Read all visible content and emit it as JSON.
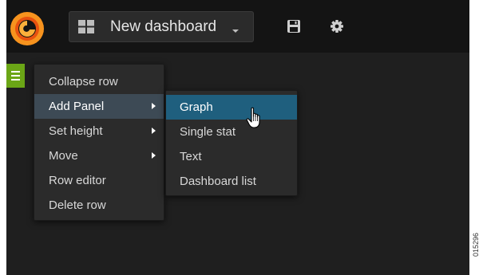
{
  "header": {
    "dashboard_title": "New dashboard"
  },
  "icons": {
    "logo": "grafana-logo",
    "dashboard_grid": "grid-icon",
    "dashboard_caret": "caret-down-icon",
    "save": "save-icon",
    "settings": "gear-icon",
    "row_menu": "hamburger-icon",
    "submenu_arrow": "chevron-right-icon",
    "cursor": "hand-pointer-icon"
  },
  "colors": {
    "navbar_bg": "#141414",
    "page_bg": "#1f1f1f",
    "menu_bg": "#2b2b2b",
    "row_button": "#6ba616",
    "active_item": "#3d4a55",
    "highlight_item": "#1f5f7e"
  },
  "row_menu": {
    "items": [
      {
        "label": "Collapse row",
        "has_submenu": false
      },
      {
        "label": "Add Panel",
        "has_submenu": true,
        "active": true
      },
      {
        "label": "Set height",
        "has_submenu": true
      },
      {
        "label": "Move",
        "has_submenu": true
      },
      {
        "label": "Row editor",
        "has_submenu": false
      },
      {
        "label": "Delete row",
        "has_submenu": false
      }
    ]
  },
  "add_panel_submenu": {
    "items": [
      {
        "label": "Graph",
        "highlighted": true
      },
      {
        "label": "Single stat"
      },
      {
        "label": "Text"
      },
      {
        "label": "Dashboard list"
      }
    ]
  },
  "figure_id": "015296"
}
